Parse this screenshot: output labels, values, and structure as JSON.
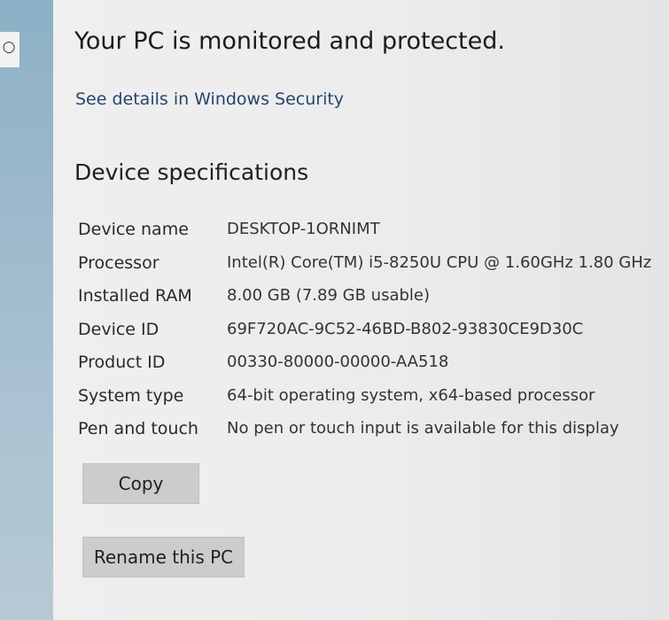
{
  "sidebar": {
    "icon": "home-icon"
  },
  "status": {
    "heading": "Your PC is monitored and protected.",
    "link": "See details in Windows Security"
  },
  "device_specifications": {
    "heading": "Device specifications",
    "rows": [
      {
        "label": "Device name",
        "value": "DESKTOP-1ORNIMT"
      },
      {
        "label": "Processor",
        "value": "Intel(R) Core(TM) i5-8250U CPU @ 1.60GHz   1.80 GHz"
      },
      {
        "label": "Installed RAM",
        "value": "8.00 GB (7.89 GB usable)"
      },
      {
        "label": "Device ID",
        "value": "69F720AC-9C52-46BD-B802-93830CE9D30C"
      },
      {
        "label": "Product ID",
        "value": "00330-80000-00000-AA518"
      },
      {
        "label": "System type",
        "value": "64-bit operating system, x64-based processor"
      },
      {
        "label": "Pen and touch",
        "value": "No pen or touch input is available for this display"
      }
    ]
  },
  "buttons": {
    "copy": "Copy",
    "rename": "Rename this PC"
  }
}
